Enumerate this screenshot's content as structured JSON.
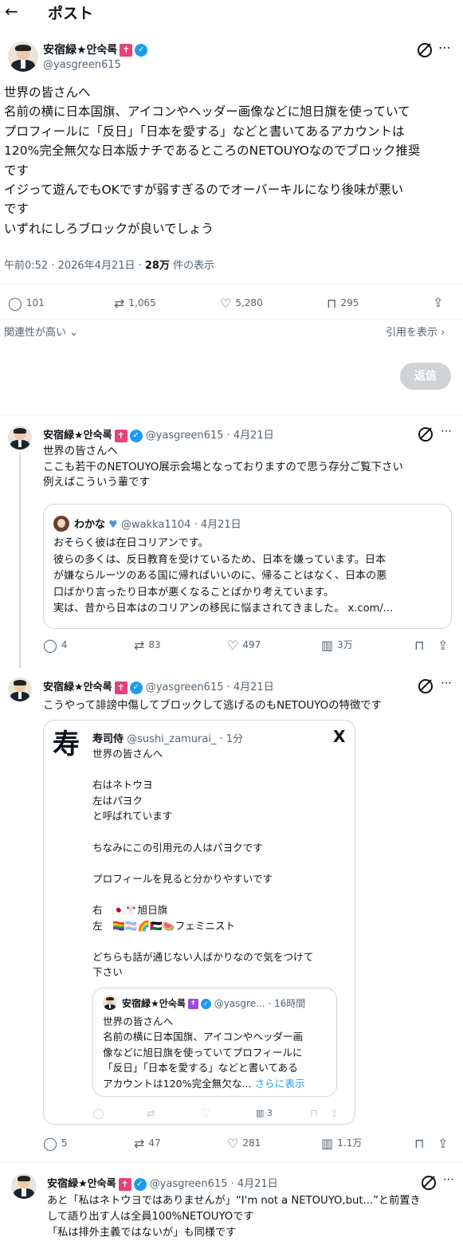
{
  "header": {
    "back_icon": "arrow-left-icon",
    "title": "ポスト"
  },
  "main_post": {
    "display_name": "安宿緑★안숙록",
    "handle": "@yasgreen615",
    "lines": [
      "世界の皆さんへ",
      "名前の横に日本国旗、アイコンやヘッダー画像などに旭日旗を使っていて",
      "プロフィールに「反日」「日本を愛する」などと書いてあるアカウントは",
      "120%完全無欠な日本版ナチであるところのNETOUYOなのでブロック推奨",
      "です",
      "イジって遊んでもOKですが弱すぎるのでオーバーキルになり後味が悪い",
      "です",
      "いずれにしろブロックが良いでしょう"
    ],
    "time": "午前0:52 · 2026年4月21日 · ",
    "views_count": "28万",
    "views_label": " 件の表示",
    "stats": {
      "replies": "101",
      "reposts": "1,065",
      "likes": "5,280",
      "bookmarks": "295"
    },
    "sort_label": "関連性が高い",
    "quote_label": "引用を表示",
    "reply_button": "返信"
  },
  "reply1": {
    "display_name": "安宿緑★안숙록",
    "meta": "@yasgreen615 · 4月21日",
    "lines": [
      "世界の皆さんへ",
      "ここも若干のNETOUYO展示会場となっておりますので思う存分ご覧下さい",
      "例えばこういう輩です"
    ],
    "quote": {
      "display_name": "わかな",
      "meta": "@wakka1104 · 4月21日",
      "lines": [
        "おそらく彼は在日コリアンです。",
        "彼らの多くは、反日教育を受けているため、日本を嫌っています。日本",
        "が嫌ならルーツのある国に帰ればいいのに、帰ることはなく、日本の悪",
        "口ばかり言ったり日本が悪くなることばかり考えています。",
        "実は、昔から日本はのコリアンの移民に悩まされてきました。 x.com/..."
      ]
    },
    "stats": {
      "replies": "4",
      "reposts": "83",
      "likes": "497",
      "views": "3万"
    }
  },
  "reply2": {
    "display_name": "安宿緑★안숙록",
    "meta": "@yasgreen615 · 4月21日",
    "text": "こうやって誹謗中傷してブロックして逃げるのもNETOUYOの特徴です",
    "embed": {
      "avatar_text": "寿",
      "display_name": "寿司侍",
      "meta": "@sushi_zamurai_ · 1分",
      "x_logo": "X",
      "lines": [
        "世界の皆さんへ",
        "",
        "右はネトウヨ",
        "左はパヨク",
        "と呼ばれています",
        "",
        "ちなみにこの引用元の人はパヨクです",
        "",
        "プロフィールを見ると分かりやすいです",
        "",
        "右　🇯🇵🎌旭日旗",
        "左　🏳️‍🌈🏳️‍⚧️🌈🇵🇸🍉フェミニスト",
        "",
        "どちらも話が通じない人ばかりなので気をつけて",
        "下さい"
      ],
      "inner_quote": {
        "display_name": "安宿緑★안숙록",
        "meta": "@yasgre... · 16時間",
        "lines": [
          "世界の皆さんへ",
          "名前の横に日本国旗、アイコンやヘッダー画",
          "像などに旭日旗を使っていてプロフィールに",
          "「反日」「日本を愛する」などと書いてある",
          "アカウントは120%完全無欠な..."
        ],
        "more": "さらに表示"
      },
      "views": "3"
    },
    "stats": {
      "replies": "5",
      "reposts": "47",
      "likes": "281",
      "views": "1.1万"
    }
  },
  "reply3": {
    "display_name": "安宿緑★안숙록",
    "meta": "@yasgreen615 · 4月21日",
    "lines": [
      "あと「私はネトウヨではありませんが」“I'm not a NETOUYO,but...”と前置き",
      "して語り出す人は全員100%NETOUYOです",
      "「私は排外主義ではないが」も同様です"
    ]
  }
}
